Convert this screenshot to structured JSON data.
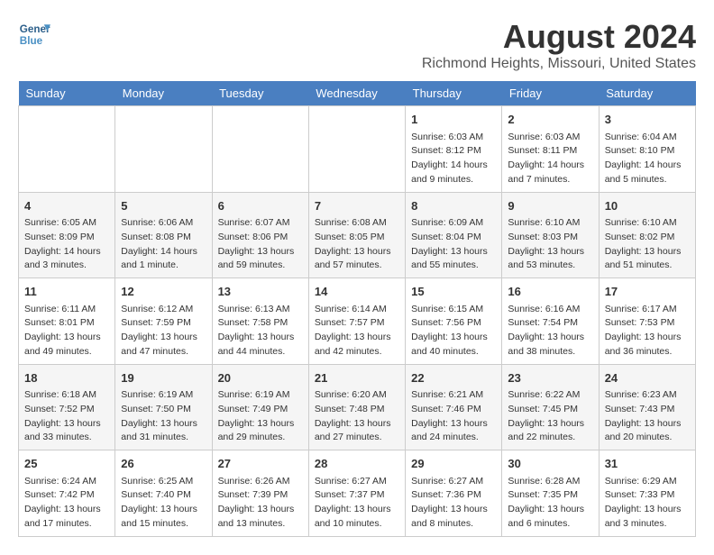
{
  "logo": {
    "line1": "General",
    "line2": "Blue"
  },
  "title": "August 2024",
  "subtitle": "Richmond Heights, Missouri, United States",
  "days_of_week": [
    "Sunday",
    "Monday",
    "Tuesday",
    "Wednesday",
    "Thursday",
    "Friday",
    "Saturday"
  ],
  "weeks": [
    [
      {
        "day": "",
        "info": ""
      },
      {
        "day": "",
        "info": ""
      },
      {
        "day": "",
        "info": ""
      },
      {
        "day": "",
        "info": ""
      },
      {
        "day": "1",
        "info": "Sunrise: 6:03 AM\nSunset: 8:12 PM\nDaylight: 14 hours\nand 9 minutes."
      },
      {
        "day": "2",
        "info": "Sunrise: 6:03 AM\nSunset: 8:11 PM\nDaylight: 14 hours\nand 7 minutes."
      },
      {
        "day": "3",
        "info": "Sunrise: 6:04 AM\nSunset: 8:10 PM\nDaylight: 14 hours\nand 5 minutes."
      }
    ],
    [
      {
        "day": "4",
        "info": "Sunrise: 6:05 AM\nSunset: 8:09 PM\nDaylight: 14 hours\nand 3 minutes."
      },
      {
        "day": "5",
        "info": "Sunrise: 6:06 AM\nSunset: 8:08 PM\nDaylight: 14 hours\nand 1 minute."
      },
      {
        "day": "6",
        "info": "Sunrise: 6:07 AM\nSunset: 8:06 PM\nDaylight: 13 hours\nand 59 minutes."
      },
      {
        "day": "7",
        "info": "Sunrise: 6:08 AM\nSunset: 8:05 PM\nDaylight: 13 hours\nand 57 minutes."
      },
      {
        "day": "8",
        "info": "Sunrise: 6:09 AM\nSunset: 8:04 PM\nDaylight: 13 hours\nand 55 minutes."
      },
      {
        "day": "9",
        "info": "Sunrise: 6:10 AM\nSunset: 8:03 PM\nDaylight: 13 hours\nand 53 minutes."
      },
      {
        "day": "10",
        "info": "Sunrise: 6:10 AM\nSunset: 8:02 PM\nDaylight: 13 hours\nand 51 minutes."
      }
    ],
    [
      {
        "day": "11",
        "info": "Sunrise: 6:11 AM\nSunset: 8:01 PM\nDaylight: 13 hours\nand 49 minutes."
      },
      {
        "day": "12",
        "info": "Sunrise: 6:12 AM\nSunset: 7:59 PM\nDaylight: 13 hours\nand 47 minutes."
      },
      {
        "day": "13",
        "info": "Sunrise: 6:13 AM\nSunset: 7:58 PM\nDaylight: 13 hours\nand 44 minutes."
      },
      {
        "day": "14",
        "info": "Sunrise: 6:14 AM\nSunset: 7:57 PM\nDaylight: 13 hours\nand 42 minutes."
      },
      {
        "day": "15",
        "info": "Sunrise: 6:15 AM\nSunset: 7:56 PM\nDaylight: 13 hours\nand 40 minutes."
      },
      {
        "day": "16",
        "info": "Sunrise: 6:16 AM\nSunset: 7:54 PM\nDaylight: 13 hours\nand 38 minutes."
      },
      {
        "day": "17",
        "info": "Sunrise: 6:17 AM\nSunset: 7:53 PM\nDaylight: 13 hours\nand 36 minutes."
      }
    ],
    [
      {
        "day": "18",
        "info": "Sunrise: 6:18 AM\nSunset: 7:52 PM\nDaylight: 13 hours\nand 33 minutes."
      },
      {
        "day": "19",
        "info": "Sunrise: 6:19 AM\nSunset: 7:50 PM\nDaylight: 13 hours\nand 31 minutes."
      },
      {
        "day": "20",
        "info": "Sunrise: 6:19 AM\nSunset: 7:49 PM\nDaylight: 13 hours\nand 29 minutes."
      },
      {
        "day": "21",
        "info": "Sunrise: 6:20 AM\nSunset: 7:48 PM\nDaylight: 13 hours\nand 27 minutes."
      },
      {
        "day": "22",
        "info": "Sunrise: 6:21 AM\nSunset: 7:46 PM\nDaylight: 13 hours\nand 24 minutes."
      },
      {
        "day": "23",
        "info": "Sunrise: 6:22 AM\nSunset: 7:45 PM\nDaylight: 13 hours\nand 22 minutes."
      },
      {
        "day": "24",
        "info": "Sunrise: 6:23 AM\nSunset: 7:43 PM\nDaylight: 13 hours\nand 20 minutes."
      }
    ],
    [
      {
        "day": "25",
        "info": "Sunrise: 6:24 AM\nSunset: 7:42 PM\nDaylight: 13 hours\nand 17 minutes."
      },
      {
        "day": "26",
        "info": "Sunrise: 6:25 AM\nSunset: 7:40 PM\nDaylight: 13 hours\nand 15 minutes."
      },
      {
        "day": "27",
        "info": "Sunrise: 6:26 AM\nSunset: 7:39 PM\nDaylight: 13 hours\nand 13 minutes."
      },
      {
        "day": "28",
        "info": "Sunrise: 6:27 AM\nSunset: 7:37 PM\nDaylight: 13 hours\nand 10 minutes."
      },
      {
        "day": "29",
        "info": "Sunrise: 6:27 AM\nSunset: 7:36 PM\nDaylight: 13 hours\nand 8 minutes."
      },
      {
        "day": "30",
        "info": "Sunrise: 6:28 AM\nSunset: 7:35 PM\nDaylight: 13 hours\nand 6 minutes."
      },
      {
        "day": "31",
        "info": "Sunrise: 6:29 AM\nSunset: 7:33 PM\nDaylight: 13 hours\nand 3 minutes."
      }
    ]
  ]
}
